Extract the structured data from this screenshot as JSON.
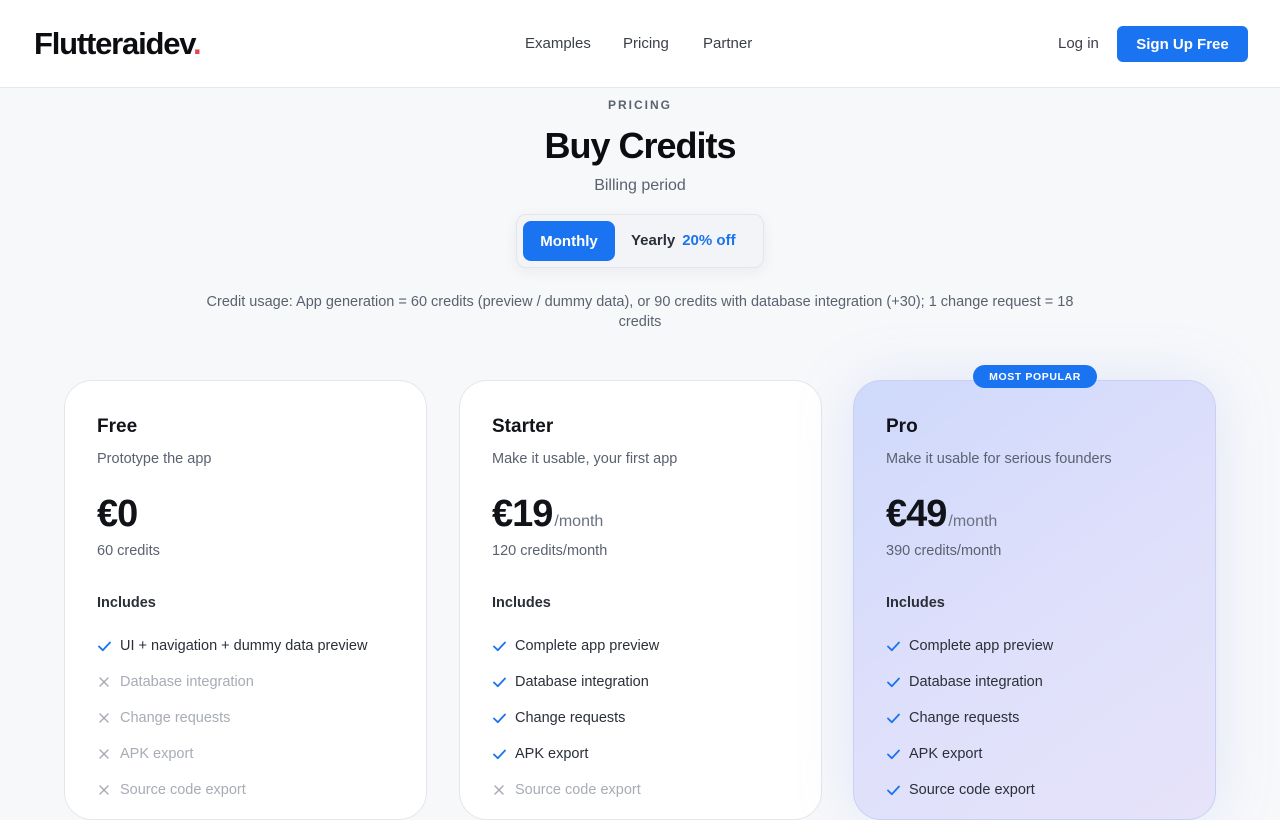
{
  "header": {
    "logo_text": "Flutteraidev",
    "logo_dot": ".",
    "nav": [
      "Examples",
      "Pricing",
      "Partner"
    ],
    "login": "Log in",
    "signup": "Sign Up Free"
  },
  "hero": {
    "eyebrow": "PRICING",
    "title": "Buy Credits",
    "billing_label": "Billing period",
    "toggle": {
      "monthly": "Monthly",
      "yearly": "Yearly",
      "discount": "20% off",
      "selected": "Monthly"
    },
    "credit_note": "Credit usage: App generation = 60 credits (preview / dummy data), or 90 credits with database integration (+30); 1 change request = 18 credits"
  },
  "colors": {
    "accent": "#1a73f0",
    "logo_dot": "#e5484d"
  },
  "plans": [
    {
      "name": "Free",
      "desc": "Prototype the app",
      "price": "€0",
      "period": "",
      "credits": "60 credits",
      "includes": "Includes",
      "features": [
        {
          "text": "UI + navigation + dummy data preview",
          "included": true
        },
        {
          "text": "Database integration",
          "included": false
        },
        {
          "text": "Change requests",
          "included": false
        },
        {
          "text": "APK export",
          "included": false
        },
        {
          "text": "Source code export",
          "included": false
        }
      ]
    },
    {
      "name": "Starter",
      "desc": "Make it usable, your first app",
      "price": "€19",
      "period": "/month",
      "credits": "120 credits/month",
      "includes": "Includes",
      "features": [
        {
          "text": "Complete app preview",
          "included": true
        },
        {
          "text": "Database integration",
          "included": true
        },
        {
          "text": "Change requests",
          "included": true
        },
        {
          "text": "APK export",
          "included": true
        },
        {
          "text": "Source code export",
          "included": false
        }
      ]
    },
    {
      "name": "Pro",
      "badge": "MOST POPULAR",
      "desc": "Make it usable for serious founders",
      "price": "€49",
      "period": "/month",
      "credits": "390 credits/month",
      "includes": "Includes",
      "features": [
        {
          "text": "Complete app preview",
          "included": true
        },
        {
          "text": "Database integration",
          "included": true
        },
        {
          "text": "Change requests",
          "included": true
        },
        {
          "text": "APK export",
          "included": true
        },
        {
          "text": "Source code export",
          "included": true
        }
      ]
    }
  ]
}
